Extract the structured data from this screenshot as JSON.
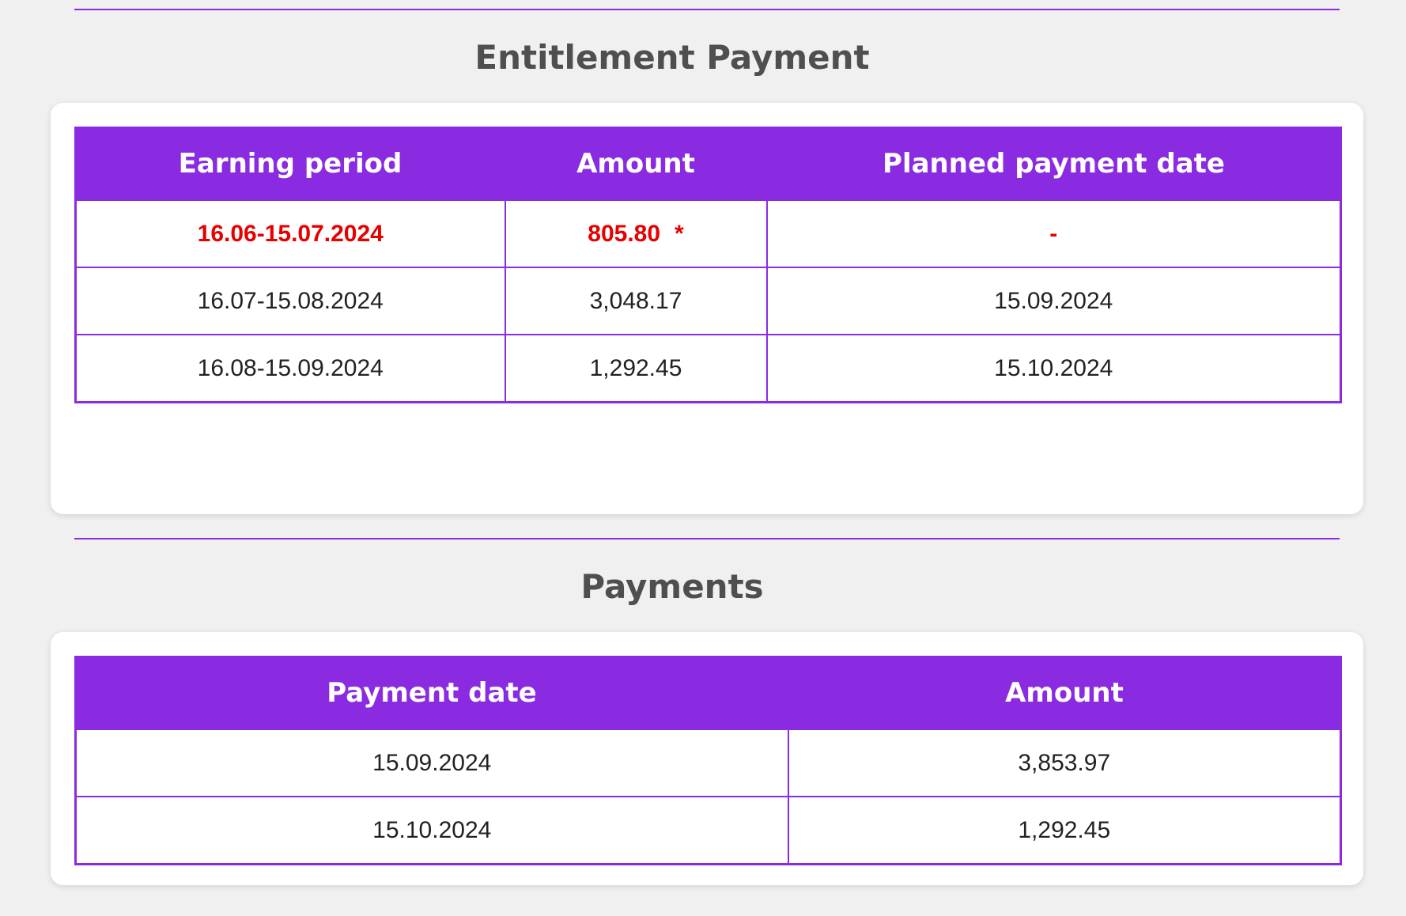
{
  "entitlement": {
    "title": "Entitlement Payment",
    "columns": [
      "Earning period",
      "Amount",
      "Planned payment date"
    ],
    "rows": [
      {
        "period": "16.06-15.07.2024",
        "amount": "805.80",
        "marker": "*",
        "planned_date": "-",
        "highlight": true
      },
      {
        "period": "16.07-15.08.2024",
        "amount": "3,048.17",
        "marker": "",
        "planned_date": "15.09.2024",
        "highlight": false
      },
      {
        "period": "16.08-15.09.2024",
        "amount": "1,292.45",
        "marker": "",
        "planned_date": "15.10.2024",
        "highlight": false
      }
    ]
  },
  "payments": {
    "title": "Payments",
    "columns": [
      "Payment date",
      "Amount"
    ],
    "rows": [
      {
        "date": "15.09.2024",
        "amount": "3,853.97"
      },
      {
        "date": "15.10.2024",
        "amount": "1,292.45"
      }
    ]
  },
  "colors": {
    "accent": "#8a2be2",
    "highlight_text": "#e60000",
    "title_text": "#4f4f4f",
    "background": "#f0f0f0"
  }
}
